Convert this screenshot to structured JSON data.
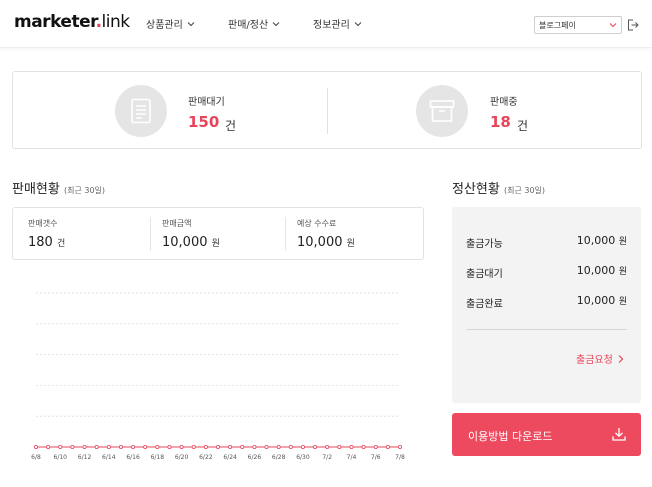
{
  "header": {
    "logo_main": "marketer",
    "logo_dot": ".",
    "logo_tail": "link",
    "nav": [
      {
        "label": "상품관리",
        "icon": "chevron-down-icon"
      },
      {
        "label": "판매/정산",
        "icon": "chevron-down-icon"
      },
      {
        "label": "정보관리",
        "icon": "chevron-down-icon"
      }
    ],
    "store_select": {
      "value": "블로그페이",
      "icon": "chevron-down-icon"
    },
    "logout_icon": "logout-icon"
  },
  "summary": {
    "waiting": {
      "label": "판매대기",
      "value": "150",
      "unit": "건",
      "icon": "document-icon"
    },
    "selling": {
      "label": "판매중",
      "value": "18",
      "unit": "건",
      "icon": "box-icon"
    }
  },
  "sales": {
    "title": "판매현황",
    "subtitle": "(최근 30일)",
    "stats": [
      {
        "label": "판매갯수",
        "value": "180",
        "unit": "건"
      },
      {
        "label": "판매금액",
        "value": "10,000",
        "unit": "원"
      },
      {
        "label": "예상 수수료",
        "value": "10,000",
        "unit": "원"
      }
    ]
  },
  "chart_data": {
    "type": "line",
    "categories": [
      "6/8",
      "6/10",
      "6/12",
      "6/14",
      "6/16",
      "6/18",
      "6/20",
      "6/22",
      "6/24",
      "6/26",
      "6/28",
      "6/30",
      "7/2",
      "7/4",
      "7/6",
      "7/8"
    ],
    "points_x": [
      "6/8",
      "6/9",
      "6/10",
      "6/11",
      "6/12",
      "6/13",
      "6/14",
      "6/15",
      "6/16",
      "6/17",
      "6/18",
      "6/19",
      "6/20",
      "6/21",
      "6/22",
      "6/23",
      "6/24",
      "6/25",
      "6/26",
      "6/27",
      "6/28",
      "6/29",
      "6/30",
      "7/1",
      "7/2",
      "7/3",
      "7/4",
      "7/5",
      "7/6",
      "7/7",
      "7/8"
    ],
    "values": [
      0,
      0,
      0,
      0,
      0,
      0,
      0,
      0,
      0,
      0,
      0,
      0,
      0,
      0,
      0,
      0,
      0,
      0,
      0,
      0,
      0,
      0,
      0,
      0,
      0,
      0,
      0,
      0,
      0,
      0,
      0
    ],
    "ylim": [
      0,
      5
    ],
    "grid": true,
    "colors": {
      "line": "#e8445a",
      "grid": "#dddddd"
    }
  },
  "settlement": {
    "title": "정산현황",
    "subtitle": "(최근 30일)",
    "rows": [
      {
        "label": "출금가능",
        "value": "10,000",
        "unit": "원"
      },
      {
        "label": "출금대기",
        "value": "10,000",
        "unit": "원"
      },
      {
        "label": "출금완료",
        "value": "10,000",
        "unit": "원"
      }
    ],
    "withdraw_label": "출금요청",
    "withdraw_icon": "chevron-right-icon"
  },
  "download": {
    "label": "이용방법 다운로드",
    "icon": "download-icon"
  },
  "colors": {
    "accent": "#e8445a",
    "button": "#ee4a5f",
    "panel": "#f3f3f3"
  }
}
